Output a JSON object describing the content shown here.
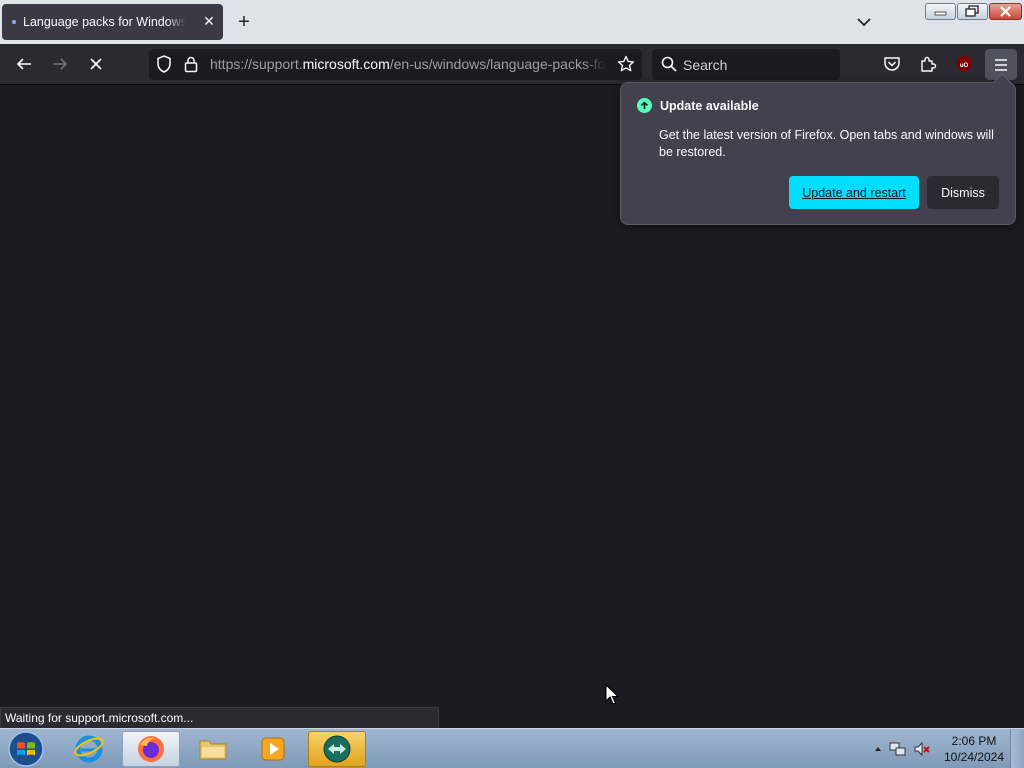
{
  "browser": {
    "tab": {
      "title": "Language packs for Windows - Microsoft Support"
    },
    "url": {
      "prefix": "https://support.",
      "domain": "microsoft.com",
      "path": "/en-us/windows/language-packs-for-windows"
    },
    "search": {
      "placeholder": "Search"
    }
  },
  "update_panel": {
    "title": "Update available",
    "message": "Get the latest version of Firefox. Open tabs and windows will be restored.",
    "primary_button": "Update and restart",
    "secondary_button": "Dismiss"
  },
  "status_bar": {
    "text": "Waiting for support.microsoft.com..."
  },
  "taskbar": {
    "clock": {
      "time": "2:06 PM",
      "date": "10/24/2024"
    }
  },
  "colors": {
    "accent": "#00ddff",
    "update_icon": "#54ffbd",
    "toolbar": "#2b2a33",
    "content_bg": "#1c1b22"
  }
}
